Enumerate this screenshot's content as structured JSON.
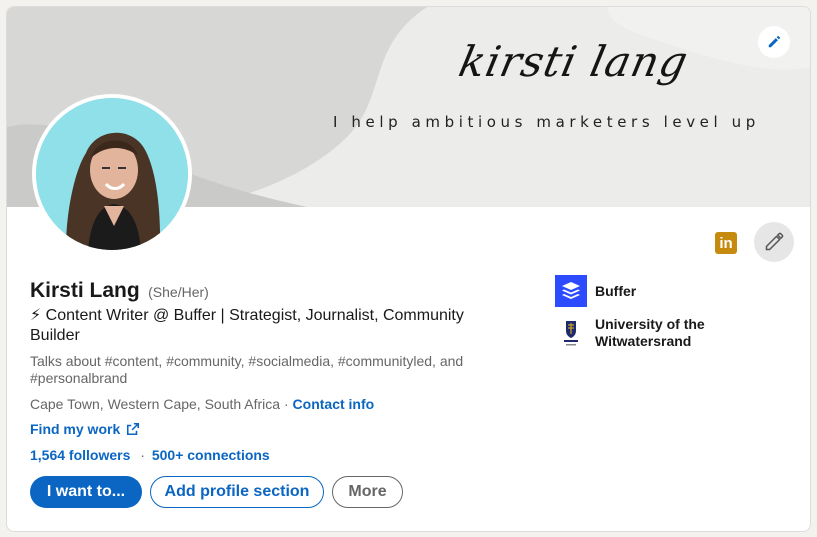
{
  "banner": {
    "name_script": "kirsti lang",
    "tagline": "I help ambitious marketers level up"
  },
  "profile": {
    "name": "Kirsti Lang",
    "pronouns": "(She/Her)",
    "headline": "⚡ Content Writer @ Buffer | Strategist, Journalist, Community Builder",
    "talks_about": "Talks about #content, #community, #socialmedia, #communityled, and #personalbrand",
    "location": "Cape Town, Western Cape, South Africa",
    "location_separator": "·",
    "contact_info": "Contact info",
    "find_work": "Find my work",
    "followers": "1,564 followers",
    "stats_separator": "·",
    "connections": "500+ connections"
  },
  "badges": {
    "linkedin": "in"
  },
  "actions": {
    "primary": "I want to...",
    "add_section": "Add profile section",
    "more": "More"
  },
  "experience": [
    {
      "name": "Buffer",
      "icon": "buffer-logo"
    },
    {
      "name": "University of the Witwatersrand",
      "icon": "wits-crest"
    }
  ],
  "colors": {
    "accent": "#0a66c2",
    "badge": "#c68a0f",
    "avatar_bg": "#8fe0e8"
  }
}
